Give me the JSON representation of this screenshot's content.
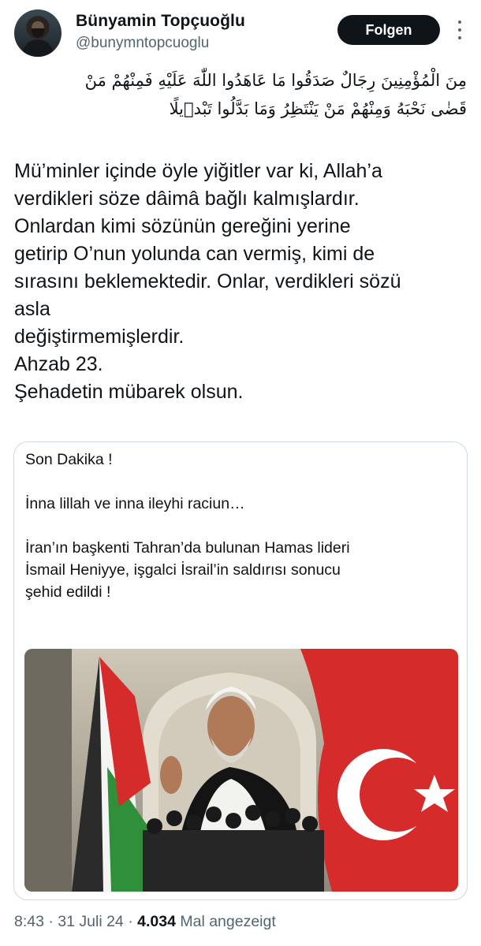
{
  "author": {
    "name": "Bünyamin Topçuoğlu",
    "handle": "@bunymntopcuoglu",
    "avatar_icon": "user-avatar"
  },
  "actions": {
    "follow_label": "Folgen",
    "more_icon": "more-vertical-icon"
  },
  "tweet": {
    "arabic_lines": [
      "مِنَ الْمُؤْمِنِينَ رِجَالٌ صَدَقُوا مَا عَاهَدُوا اللّٰهَ عَلَيْهِ فَمِنْهُمْ مَنْ",
      "قَضٰى نَحْبَهُ وَمِنْهُمْ مَنْ يَنْتَظِرُ وَمَا بَدَّلُوا تَبْدٖيلًا"
    ],
    "text_lines": [
      "Mü’minler içinde öyle yiğitler var ki, Allah’a",
      "verdikleri söze dâimâ bağlı kalmışlardır.",
      "Onlardan kimi sözünün gereğini yerine",
      "getirip O’nun yolunda can vermiş, kimi de",
      "sırasını beklemektedir. Onlar, verdikleri sözü",
      "asla",
      "değiştirmemişlerdir.",
      "Ahzab 23.",
      "Şehadetin mübarek olsun."
    ]
  },
  "embedded_card": {
    "headline": "Son Dakika !",
    "line1": "İnna lillah ve inna ileyhi raciun…",
    "body_lines": [
      "İran’ın başkenti Tahran’da bulunan Hamas lideri",
      "İsmail Heniyye, işgalci İsrail’in saldırısı sonucu",
      "şehid edildi !"
    ]
  },
  "meta": {
    "time": "8:43",
    "separator": " · ",
    "date": "31 Juli 24",
    "views_count": "4.034",
    "views_label": " Mal angezeigt"
  },
  "colors": {
    "text": "#0f1419",
    "secondary": "#536471",
    "border": "#cfd9de",
    "button_bg": "#0f1419",
    "flag_red": "#d62b2b",
    "flag_green": "#2f8f3a"
  }
}
